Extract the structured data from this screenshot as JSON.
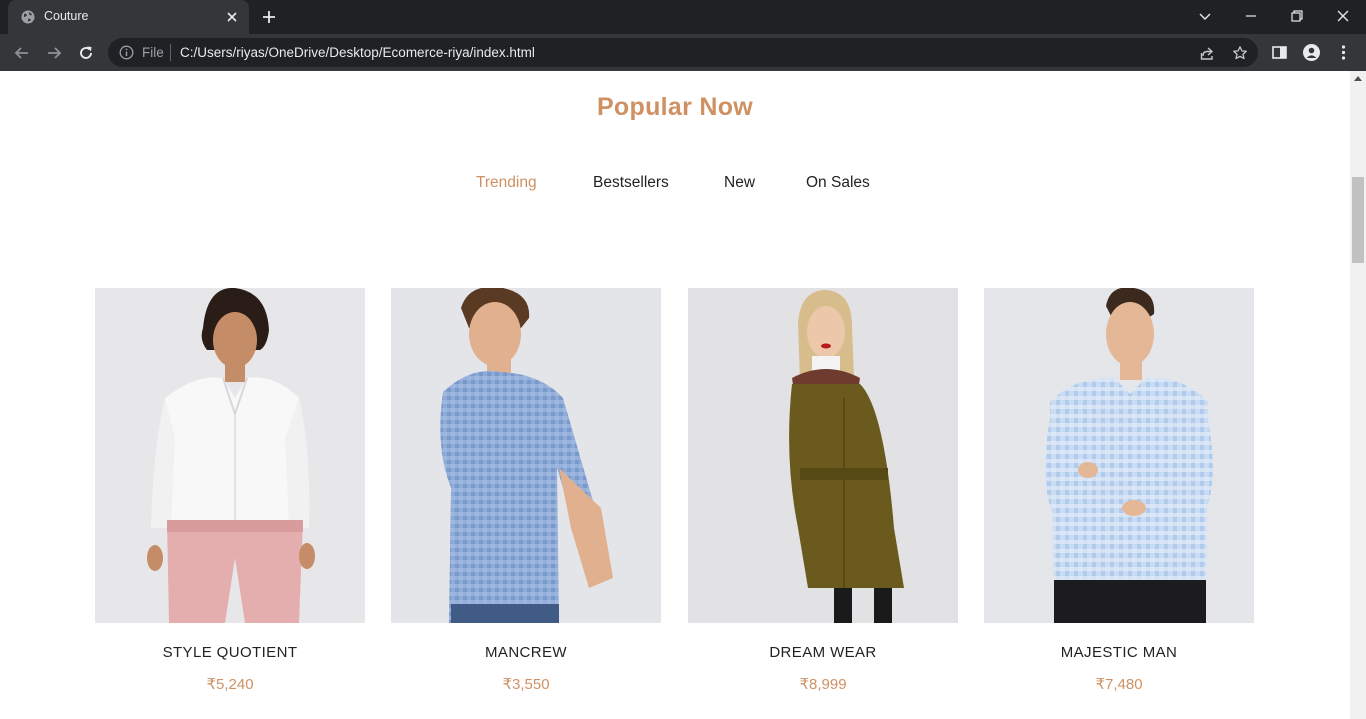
{
  "browser": {
    "tab_title": "Couture",
    "file_label": "File",
    "url": "C:/Users/riyas/OneDrive/Desktop/Ecomerce-riya/index.html"
  },
  "page": {
    "section_title": "Popular Now",
    "filters": [
      {
        "label": "Trending",
        "active": true
      },
      {
        "label": "Bestsellers",
        "active": false
      },
      {
        "label": "New",
        "active": false
      },
      {
        "label": "On Sales",
        "active": false
      }
    ],
    "products": [
      {
        "name": "STYLE QUOTIENT",
        "price": "₹5,240",
        "image": "woman-white-shirt-pink-trousers"
      },
      {
        "name": "MANCREW",
        "price": "₹3,550",
        "image": "man-blue-check-shirt"
      },
      {
        "name": "DREAM WEAR",
        "price": "₹8,999",
        "image": "woman-olive-coat"
      },
      {
        "name": "MAJESTIC MAN",
        "price": "₹7,480",
        "image": "man-light-blue-check-shirt"
      }
    ]
  },
  "colors": {
    "accent": "#cf9164",
    "text": "#222222",
    "chrome_dark": "#202124",
    "chrome_tab": "#35363a"
  }
}
